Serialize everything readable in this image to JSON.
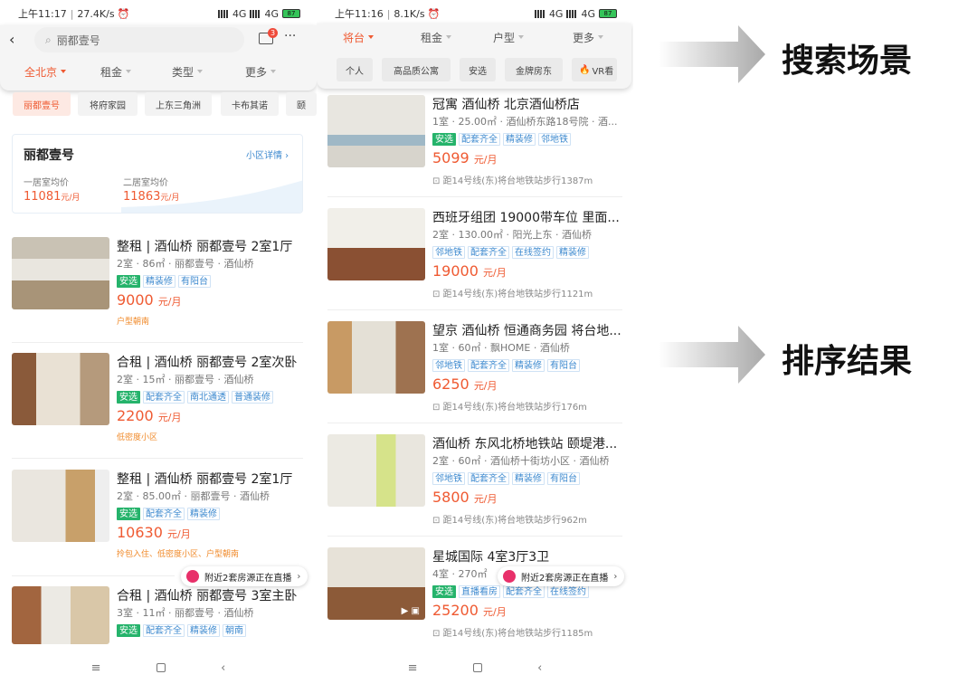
{
  "left_phone": {
    "status": {
      "time": "上午11:17",
      "speed": "27.4K/s",
      "net1": "4G",
      "net2": "4G",
      "battery": "87"
    },
    "search_placeholder": "丽都壹号",
    "msg_badge": "3",
    "filters": [
      "全北京",
      "租金",
      "类型",
      "更多"
    ],
    "chips": [
      "丽都壹号",
      "将府家园",
      "上东三角洲",
      "卡布其诺",
      "颐"
    ],
    "community": {
      "name": "丽都壹号",
      "detail_link": "小区详情",
      "one_room_label": "一居室均价",
      "one_room_value": "11081",
      "two_room_label": "二居室均价",
      "two_room_value": "11863",
      "unit": "元/月"
    },
    "listings": [
      {
        "title": "整租 | 酒仙桥 丽都壹号 2室1厅",
        "meta": "2室 · 86㎡ · 丽都壹号 · 酒仙桥",
        "tags": [
          "安选",
          "精装修",
          "有阳台"
        ],
        "price": "9000",
        "unit": "元/月",
        "extra": "户型朝南"
      },
      {
        "title": "合租 | 酒仙桥 丽都壹号 2室次卧",
        "meta": "2室 · 15㎡ · 丽都壹号 · 酒仙桥",
        "tags": [
          "安选",
          "配套齐全",
          "南北通透",
          "普通装修"
        ],
        "price": "2200",
        "unit": "元/月",
        "extra": "低密度小区"
      },
      {
        "title": "整租 | 酒仙桥 丽都壹号 2室1厅",
        "meta": "2室 · 85.00㎡ · 丽都壹号 · 酒仙桥",
        "tags": [
          "安选",
          "配套齐全",
          "精装修"
        ],
        "price": "10630",
        "unit": "元/月",
        "extra": "拎包入住、低密度小区、户型朝南"
      },
      {
        "title": "合租 | 酒仙桥 丽都壹号 3室主卧",
        "meta": "3室 · 11㎡ · 丽都壹号 · 酒仙桥",
        "tags": [
          "安选",
          "配套齐全",
          "精装修",
          "朝南"
        ],
        "price": "",
        "unit": "",
        "extra": ""
      }
    ],
    "live_banner": "附近2套房源正在直播"
  },
  "right_phone": {
    "status": {
      "time": "上午11:16",
      "speed": "8.1K/s",
      "net1": "4G",
      "net2": "4G",
      "battery": "87"
    },
    "filters": [
      "将台",
      "租金",
      "户型",
      "更多"
    ],
    "chips": [
      "个人",
      "高品质公寓",
      "安选",
      "金牌房东",
      "VR看"
    ],
    "listings": [
      {
        "title": "冠寓 酒仙桥 北京酒仙桥店",
        "meta": "1室 · 25.00㎡ · 酒仙桥东路18号院 · 酒...",
        "tags": [
          "安选",
          "配套齐全",
          "精装修",
          "邻地铁"
        ],
        "price": "5099",
        "unit": "元/月",
        "sub": "距14号线(东)将台地铁站步行1387m"
      },
      {
        "title": "西班牙组团 19000带车位 里面...",
        "meta": "2室 · 130.00㎡ · 阳光上东 · 酒仙桥",
        "tags": [
          "邻地铁",
          "配套齐全",
          "在线签约",
          "精装修"
        ],
        "price": "19000",
        "unit": "元/月",
        "sub": "距14号线(东)将台地铁站步行1121m"
      },
      {
        "title": "望京 酒仙桥 恒通商务园 将台地...",
        "meta": "1室 · 60㎡ · 飘HOME · 酒仙桥",
        "tags": [
          "邻地铁",
          "配套齐全",
          "精装修",
          "有阳台"
        ],
        "price": "6250",
        "unit": "元/月",
        "sub": "距14号线(东)将台地铁站步行176m"
      },
      {
        "title": "酒仙桥 东风北桥地铁站 颐堤港...",
        "meta": "2室 · 60㎡ · 酒仙桥十街坊小区 · 酒仙桥",
        "tags": [
          "邻地铁",
          "配套齐全",
          "精装修",
          "有阳台"
        ],
        "price": "5800",
        "unit": "元/月",
        "sub": "距14号线(东)将台地铁站步行962m"
      },
      {
        "title": "星城国际 4室3厅3卫",
        "meta": "4室 · 270㎡",
        "tags": [
          "安选",
          "直播看房",
          "配套齐全",
          "在线签约"
        ],
        "price": "25200",
        "unit": "元/月",
        "sub": "距14号线(东)将台地铁站步行1185m"
      }
    ],
    "live_banner": "附近2套房源正在直播"
  },
  "annotations": {
    "search_label": "搜索场景",
    "sort_label": "排序结果"
  },
  "nav_icons": [
    "menu-icon",
    "home-icon",
    "back-icon"
  ],
  "colors": {
    "accent": "#ef5a32",
    "tag_green": "#25b36b",
    "tag_blue": "#3c89cf"
  }
}
